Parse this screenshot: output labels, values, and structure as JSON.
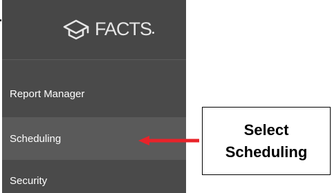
{
  "logo": {
    "text": "FACTS",
    "icon": "graduation-cap-icon",
    "text_color": "#e6e6e6"
  },
  "sidebar": {
    "background": "#4a4a4a",
    "highlight": "#5a5a5a",
    "items": [
      {
        "label": "Report Manager",
        "selected": false
      },
      {
        "label": "Scheduling",
        "selected": true
      },
      {
        "label": "Security",
        "selected": false
      }
    ]
  },
  "annotation": {
    "line1": "Select",
    "line2": "Scheduling",
    "arrow_color": "#e8232a",
    "arrow_icon": "left-arrow-icon"
  }
}
